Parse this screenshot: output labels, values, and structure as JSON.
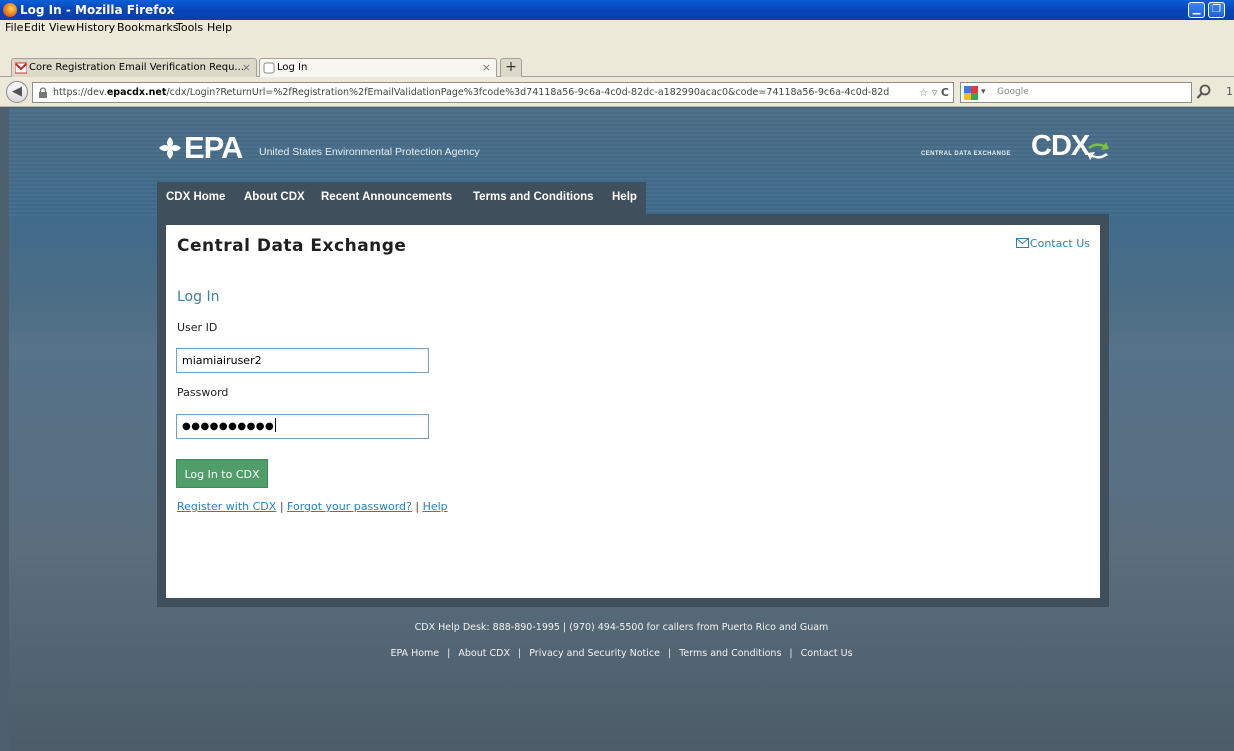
{
  "window": {
    "title": "Log In - Mozilla Firefox"
  },
  "menubar": [
    "File",
    "Edit",
    "View",
    "History",
    "Bookmarks",
    "Tools",
    "Help"
  ],
  "tabs": [
    {
      "label": "Core Registration Email Verification Requ...",
      "icon": "gmail-icon",
      "active": false
    },
    {
      "label": "Log In",
      "icon": "blank-page-icon",
      "active": true
    }
  ],
  "newtab_label": "+",
  "addressbar": {
    "url_prefix": "https://dev.",
    "url_host": "epacdx.net",
    "url_rest": "/cdx/Login?ReturnUrl=%2fRegistration%2fEmailValidationPage%3fcode%3d74118a56-9c6a-4c0d-82dc-a182990acac0&code=74118a56-9c6a-4c0d-82d"
  },
  "searchbar": {
    "placeholder": "Google"
  },
  "header": {
    "epa_word": "EPA",
    "agency_name": "United States Environmental Protection Agency",
    "cdx_small": "CENTRAL DATA EXCHANGE",
    "cdx_big": "CDX"
  },
  "topnav": [
    {
      "label": "CDX Home"
    },
    {
      "label": "About CDX"
    },
    {
      "label": "Recent Announcements"
    },
    {
      "label": "Terms and Conditions"
    },
    {
      "label": "Help"
    }
  ],
  "panel": {
    "title": "Central Data Exchange",
    "contact_label": "Contact Us",
    "login_heading": "Log In",
    "userid_label": "User ID",
    "userid_value": "miamiairuser2",
    "password_label": "Password",
    "password_mask": "●●●●●●●●●●",
    "login_button": "Log In to CDX",
    "links": {
      "register": "Register with CDX",
      "forgot": "Forgot your password?",
      "help": "Help",
      "separator": "|"
    }
  },
  "footer": {
    "helpdesk": "CDX Help Desk: 888-890-1995 | (970) 494-5500 for callers from Puerto Rico and Guam",
    "links": [
      "EPA Home",
      "About CDX",
      "Privacy and Security Notice",
      "Terms and Conditions",
      "Contact Us"
    ],
    "separator": "|"
  },
  "colors": {
    "titlebar": "#0a5fd8",
    "nav_bg": "#3f4f5b",
    "heading_blue": "#3f7fa8",
    "link_blue": "#2a7fbf",
    "button_green": "#4f9e6a"
  }
}
